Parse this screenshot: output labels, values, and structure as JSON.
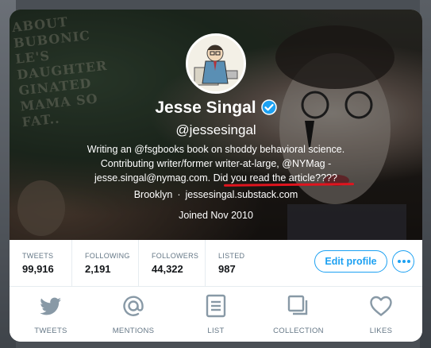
{
  "profile": {
    "name": "Jesse Singal",
    "handle": "@jessesingal",
    "bio_line1": "Writing an @fsgbooks book on shoddy behavioral science.",
    "bio_line2": "Contributing writer/former writer-at-large, @NYMag -",
    "bio_line3_plain": "jesse.singal@nymag.com. ",
    "bio_line3_highlight": "Did you read the article????",
    "location": "Brooklyn",
    "separator": "·",
    "website": "jessesingal.substack.com",
    "joined": "Joined Nov 2010"
  },
  "banner_chalk": {
    "line1": "ABOUT",
    "line2": "BUBONIC",
    "line3": "LE'S DAUGHTER",
    "line4": "GINATED",
    "line5": "MAMA SO FAT.."
  },
  "stats": [
    {
      "label": "TWEETS",
      "value": "99,916"
    },
    {
      "label": "FOLLOWING",
      "value": "2,191"
    },
    {
      "label": "FOLLOWERS",
      "value": "44,322"
    },
    {
      "label": "LISTED",
      "value": "987"
    }
  ],
  "actions": {
    "edit_profile": "Edit profile"
  },
  "nav": [
    {
      "label": "TWEETS",
      "icon": "bird-icon"
    },
    {
      "label": "MENTIONS",
      "icon": "at-icon"
    },
    {
      "label": "LIST",
      "icon": "list-icon"
    },
    {
      "label": "COLLECTION",
      "icon": "collection-icon"
    },
    {
      "label": "LIKES",
      "icon": "heart-icon"
    }
  ],
  "colors": {
    "accent": "#1da1f2",
    "icon_gray": "#8899a6",
    "underline": "#e0141e"
  }
}
